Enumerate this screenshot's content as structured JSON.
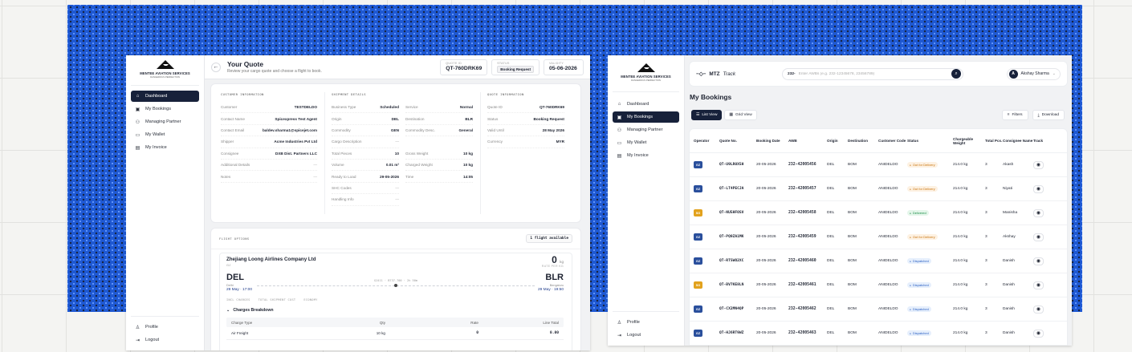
{
  "brand": {
    "logo_line1": "MENTEE AVIATION SERVICES",
    "logo_line2": "DANGEROUS PERFECTION"
  },
  "quote_window": {
    "nav": [
      {
        "label": "Dashboard",
        "icon": "home-icon",
        "active": true
      },
      {
        "label": "My Bookings",
        "icon": "calendar-icon",
        "active": false
      },
      {
        "label": "Managing Partner",
        "icon": "users-icon",
        "active": false
      },
      {
        "label": "My Wallet",
        "icon": "wallet-icon",
        "active": false
      },
      {
        "label": "My Invoice",
        "icon": "document-icon",
        "active": false
      }
    ],
    "nav_bottom": [
      {
        "label": "Profile",
        "icon": "user-icon"
      },
      {
        "label": "Logout",
        "icon": "logout-icon"
      }
    ],
    "title": "Your Quote",
    "subtitle": "Review your cargo quote and choose a flight to book.",
    "quote_id_label": "QUOTE ID",
    "quote_id": "QT-760DRK69",
    "status_label": "STATUS",
    "status": "Booking Request",
    "validity_label": "VALIDITY",
    "validity": "05-06-2026",
    "customer": {
      "header": "CUSTOMER INFORMATION",
      "rows": [
        {
          "k": "Customer",
          "v": "TESTDELDO"
        },
        {
          "k": "Contact Name",
          "v": "Spicexpress Test Agent"
        },
        {
          "k": "Contact Email",
          "v": "baldev.sharma1@spicejet.com"
        },
        {
          "k": "Shipper",
          "v": "Acme Industries Pvt Ltd"
        },
        {
          "k": "Consignee",
          "v": "DXB Dist. Partners LLC"
        },
        {
          "k": "Additional Details",
          "v": "—"
        },
        {
          "k": "Notes",
          "v": "—"
        }
      ]
    },
    "shipment": {
      "header": "SHIPMENT DETAILS",
      "left": [
        {
          "k": "Business Type",
          "v": "Scheduled"
        },
        {
          "k": "Origin",
          "v": "DEL"
        },
        {
          "k": "Commodity",
          "v": "GEN"
        },
        {
          "k": "Cargo Description",
          "v": "—"
        },
        {
          "k": "Total Pieces",
          "v": "10"
        },
        {
          "k": "Volume",
          "v": "0.01 m³"
        },
        {
          "k": "Ready to Load",
          "v": "29-05-2026"
        },
        {
          "k": "SHC Codes",
          "v": "—"
        },
        {
          "k": "Handling Info",
          "v": "—"
        }
      ],
      "right": [
        {
          "k": "Service",
          "v": "Normal"
        },
        {
          "k": "Destination",
          "v": "BLR"
        },
        {
          "k": "Commodity Desc.",
          "v": "General"
        },
        {
          "k": "",
          "v": ""
        },
        {
          "k": "Gross Weight",
          "v": "10 kg"
        },
        {
          "k": "Charged Weight",
          "v": "10 kg"
        },
        {
          "k": "Time",
          "v": "14:05"
        }
      ]
    },
    "quote_info": {
      "header": "QUOTE INFORMATION",
      "rows": [
        {
          "k": "Quote ID",
          "v": "QT-760DRK69"
        },
        {
          "k": "Status",
          "v": "Booking Request"
        },
        {
          "k": "Valid Until",
          "v": "28 May 2026"
        },
        {
          "k": "Currency",
          "v": "MYR"
        }
      ]
    },
    "flight_options": {
      "title": "FLIGHT OPTIONS",
      "badge": "1 flight available",
      "airline": "Zhejiang Loong Airlines Company Ltd",
      "airline_code": "GJ",
      "weight": "0",
      "weight_unit": "kg",
      "weight_label": "RATE PER KG",
      "origin": "DEL",
      "origin_city": "Delhi",
      "origin_time": "29 May · 17:00",
      "destination": "BLR",
      "destination_city": "Bengaluru",
      "destination_time": "29 May · 19:50",
      "route_label": "GJ411 · B737-700 · 2h 50m",
      "tags": [
        "INCL CHARGES",
        "TOTAL SHIPMENT COST",
        "ECONOMY"
      ],
      "charges_label": "Charges Breakdown",
      "charge_headers": [
        "Charge Type",
        "Qty",
        "Rate",
        "Line Total"
      ],
      "charges": [
        {
          "type": "Air Freight",
          "qty": "10 kg",
          "rate": "0",
          "total": "0.00"
        }
      ]
    }
  },
  "bookings_window": {
    "nav": [
      {
        "label": "Dashboard",
        "icon": "home-icon",
        "active": false
      },
      {
        "label": "My Bookings",
        "icon": "calendar-icon",
        "active": true
      },
      {
        "label": "Managing Partner",
        "icon": "users-icon",
        "active": false
      },
      {
        "label": "My Wallet",
        "icon": "wallet-icon",
        "active": false
      },
      {
        "label": "My Invoice",
        "icon": "document-icon",
        "active": false
      }
    ],
    "nav_bottom": [
      {
        "label": "Profile",
        "icon": "user-icon"
      },
      {
        "label": "Logout",
        "icon": "logout-icon"
      }
    ],
    "app_name": "MTZ",
    "app_name_suffix": "Track",
    "search_prefix": "232-",
    "search_placeholder": "Enter AWBs (e.g. 232-12345678, 23456789)",
    "user_initial": "A",
    "user_name": "Akshay Sharma",
    "page_title": "My Bookings",
    "view_list": "List View",
    "view_grid": "Grid View",
    "filters": "Filters",
    "download": "Download",
    "columns": [
      "Operator",
      "Quote No.",
      "Booking Date",
      "AWB",
      "Origin",
      "Destination",
      "Customer Code",
      "Status",
      "Chargeable Weight",
      "Total Pcs.",
      "Consignee Name",
      "Track"
    ],
    "status_colors": {
      "Out for Delivery": {
        "bg": "#fdf1e2",
        "fg": "#c9730b"
      },
      "Delivered": {
        "bg": "#e4f6ea",
        "fg": "#1e8e4a"
      },
      "Dispatched": {
        "bg": "#e6effc",
        "fg": "#2f63c4"
      }
    },
    "operator_colors": {
      "GZ": "#2a4f9c",
      "SG": "#e2a21d"
    },
    "rows": [
      {
        "op": "GZ",
        "quote": "QT-U9LR0X5H",
        "date": "20-05-2026",
        "awb": "232-42005456",
        "origin": "DEL",
        "dest": "BOM",
        "cust": "ANIDELDO",
        "status": "Out for Delivery",
        "weight": "214.0 kg",
        "pcs": "3",
        "consignee": "Akash"
      },
      {
        "op": "GZ",
        "quote": "QT-LT4PECJA",
        "date": "20-05-2026",
        "awb": "232-42005457",
        "origin": "DEL",
        "dest": "BOM",
        "cust": "ANIDELDO",
        "status": "Out for Delivery",
        "weight": "214.0 kg",
        "pcs": "3",
        "consignee": "Niyati"
      },
      {
        "op": "SG",
        "quote": "QT-NU5HFOSV",
        "date": "20-05-2026",
        "awb": "232-42005458",
        "origin": "DEL",
        "dest": "BOM",
        "cust": "ANIDELDO",
        "status": "Delivered",
        "weight": "214.0 kg",
        "pcs": "3",
        "consignee": "Manisha"
      },
      {
        "op": "GZ",
        "quote": "QT-PQ9ZA1MK",
        "date": "20-05-2026",
        "awb": "232-42005459",
        "origin": "DEL",
        "dest": "BOM",
        "cust": "ANIDELDO",
        "status": "Out for Delivery",
        "weight": "214.0 kg",
        "pcs": "3",
        "consignee": "Akshay"
      },
      {
        "op": "GZ",
        "quote": "QT-RTSWO2XC",
        "date": "20-05-2026",
        "awb": "232-42005460",
        "origin": "DEL",
        "dest": "BOM",
        "cust": "ANIDELDO",
        "status": "Dispatched",
        "weight": "214.0 kg",
        "pcs": "3",
        "consignee": "Danish"
      },
      {
        "op": "SG",
        "quote": "QT-BV7KE8LN",
        "date": "20-05-2026",
        "awb": "232-42005461",
        "origin": "DEL",
        "dest": "BOM",
        "cust": "ANIDELDO",
        "status": "Dispatched",
        "weight": "214.0 kg",
        "pcs": "3",
        "consignee": "Danish"
      },
      {
        "op": "GZ",
        "quote": "QT-CX2MN4QP",
        "date": "20-05-2026",
        "awb": "232-42005462",
        "origin": "DEL",
        "dest": "BOM",
        "cust": "ANIDELDO",
        "status": "Dispatched",
        "weight": "214.0 kg",
        "pcs": "3",
        "consignee": "Danish"
      },
      {
        "op": "GZ",
        "quote": "QT-HJ6RT9WZ",
        "date": "20-05-2026",
        "awb": "232-42005463",
        "origin": "DEL",
        "dest": "BOM",
        "cust": "ANIDELDO",
        "status": "Dispatched",
        "weight": "214.0 kg",
        "pcs": "3",
        "consignee": "Danish"
      }
    ]
  }
}
